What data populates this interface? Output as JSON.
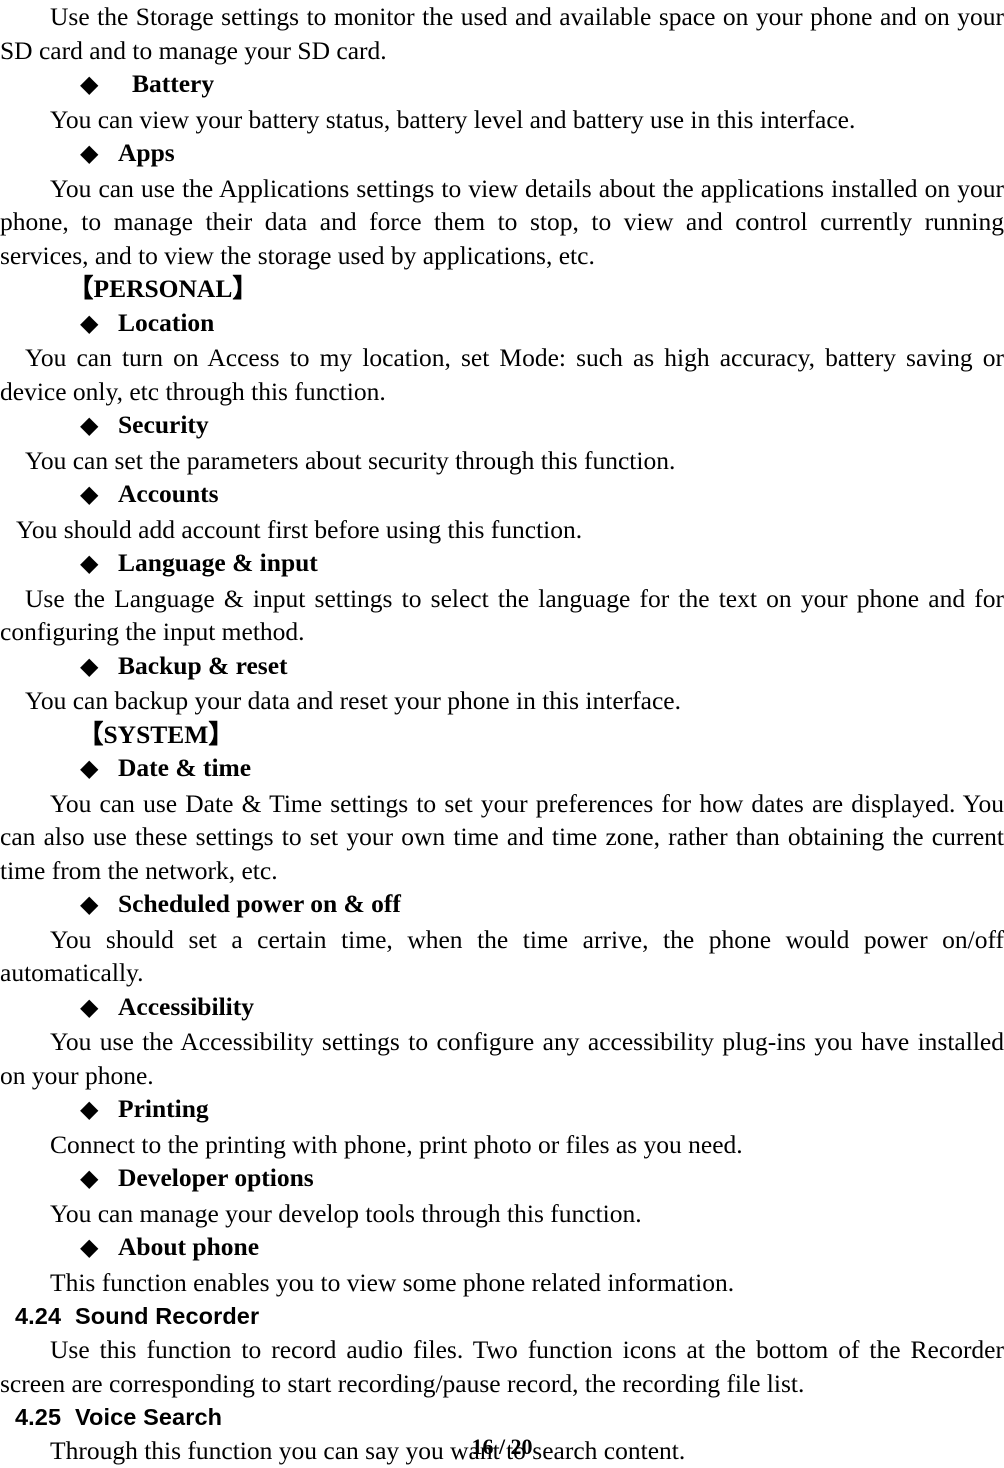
{
  "document": {
    "body_blocks": [
      {
        "kind": "paragraph",
        "indent": "large",
        "justify": true,
        "text": "Use the Storage settings to monitor the used and available space on your phone and on your SD card and to manage your SD card."
      },
      {
        "kind": "bullet",
        "bullet_glyph": "◆",
        "gap": "wide",
        "label": "Battery"
      },
      {
        "kind": "paragraph",
        "indent": "large",
        "justify": false,
        "text": "You can view your battery status, battery level and battery use in this interface."
      },
      {
        "kind": "bullet",
        "bullet_glyph": "◆",
        "gap": "normal",
        "label": "Apps"
      },
      {
        "kind": "paragraph",
        "indent": "large",
        "justify": true,
        "text": "You can use the Applications settings to view details about the applications installed on your phone, to manage their data and force them to stop, to view and control currently running services, and to view the storage used by applications, etc."
      },
      {
        "kind": "group",
        "indent": "personal",
        "text": "【PERSONAL】"
      },
      {
        "kind": "bullet",
        "bullet_glyph": "◆",
        "gap": "normal",
        "label": "Location"
      },
      {
        "kind": "paragraph",
        "indent": "small",
        "justify": true,
        "text": "You can turn on Access to my location, set Mode: such as high accuracy, battery saving or device only, etc through this function."
      },
      {
        "kind": "bullet",
        "bullet_glyph": "◆",
        "gap": "normal",
        "label": "Security"
      },
      {
        "kind": "paragraph",
        "indent": "small",
        "justify": false,
        "text": "You can set the parameters about security through this function."
      },
      {
        "kind": "bullet",
        "bullet_glyph": "◆",
        "gap": "normal",
        "label": "Accounts"
      },
      {
        "kind": "paragraph",
        "indent": "extra-small",
        "justify": false,
        "text": "You should add account first before using this function."
      },
      {
        "kind": "bullet",
        "bullet_glyph": "◆",
        "gap": "normal",
        "label": "Language & input"
      },
      {
        "kind": "paragraph",
        "indent": "small",
        "justify": true,
        "text": "Use the Language & input settings to select the language for the text on your phone and for configuring the input method."
      },
      {
        "kind": "bullet",
        "bullet_glyph": "◆",
        "gap": "normal",
        "label": "Backup & reset"
      },
      {
        "kind": "paragraph",
        "indent": "small",
        "justify": false,
        "text": "You can backup your data and reset your phone in this interface."
      },
      {
        "kind": "group",
        "indent": "system",
        "text": "【SYSTEM】"
      },
      {
        "kind": "bullet",
        "bullet_glyph": "◆",
        "gap": "normal",
        "label": "Date & time"
      },
      {
        "kind": "paragraph",
        "indent": "large",
        "justify": true,
        "text": "You can use Date & Time settings to set your preferences for how dates are displayed. You can also use these settings to set your own time and time zone, rather than obtaining the current time from the network, etc."
      },
      {
        "kind": "bullet",
        "bullet_glyph": "◆",
        "gap": "normal",
        "label": "Scheduled power on & off"
      },
      {
        "kind": "paragraph",
        "indent": "large",
        "justify": true,
        "text": "You should set a certain time, when the time arrive, the phone would power on/off automatically."
      },
      {
        "kind": "bullet",
        "bullet_glyph": "◆",
        "gap": "normal",
        "label": "Accessibility"
      },
      {
        "kind": "paragraph",
        "indent": "large",
        "justify": true,
        "text": "You use the Accessibility settings to configure any accessibility plug-ins you have installed on your phone."
      },
      {
        "kind": "bullet",
        "bullet_glyph": "◆",
        "gap": "normal",
        "label": "Printing"
      },
      {
        "kind": "paragraph",
        "indent": "large",
        "justify": false,
        "text": "Connect to the printing with phone, print photo or files as you need."
      },
      {
        "kind": "bullet",
        "bullet_glyph": "◆",
        "gap": "normal",
        "label": "Developer options"
      },
      {
        "kind": "paragraph",
        "indent": "large",
        "justify": false,
        "text": "You can manage your develop tools through this function."
      },
      {
        "kind": "bullet",
        "bullet_glyph": "◆",
        "gap": "normal",
        "label": "About phone"
      },
      {
        "kind": "paragraph",
        "indent": "large",
        "justify": false,
        "text": "This function enables you to view some phone related information."
      },
      {
        "kind": "section",
        "number": "4.24",
        "title": "Sound Recorder"
      },
      {
        "kind": "paragraph",
        "indent": "large",
        "justify": true,
        "text": "Use this function to record audio files. Two function icons at the bottom of the Recorder screen are corresponding to start recording/pause record, the recording file list."
      },
      {
        "kind": "section",
        "number": "4.25",
        "title": "Voice Search"
      },
      {
        "kind": "paragraph",
        "indent": "large",
        "justify": false,
        "text": "Through this function you can say you want to search content."
      }
    ],
    "footer": {
      "page_number": "16",
      "separator": "/",
      "total_pages": "20",
      "text": "16 / 20"
    }
  }
}
